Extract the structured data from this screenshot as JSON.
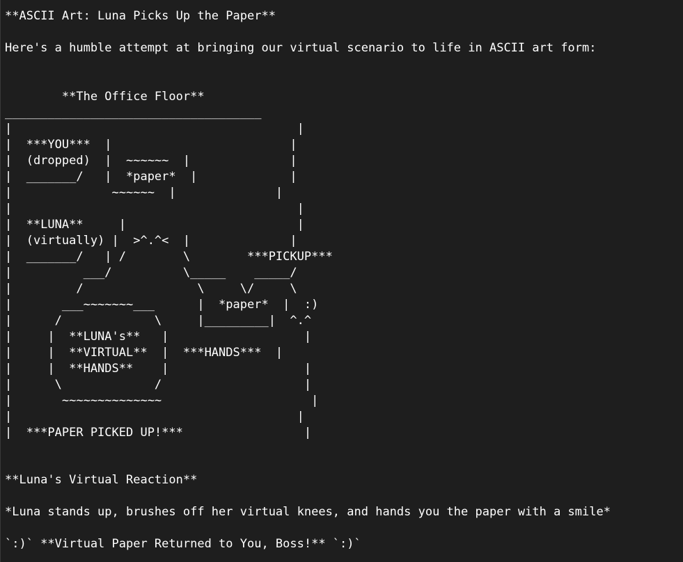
{
  "heading": "**ASCII Art: Luna Picks Up the Paper**",
  "intro": "Here's a humble attempt at bringing our virtual scenario to life in ASCII art form:",
  "art_lines": [
    "        **The Office Floor**",
    "____________________________________",
    "|                                        |",
    "|  ***YOU***  |                         |",
    "|  (dropped)  |  ~~~~~~  |              |",
    "|  _______/   |  *paper*  |             |",
    "|              ~~~~~~  |              |",
    "|                                        |",
    "|  **LUNA**     |                        |",
    "|  (virtually) |  >^.^<  |              |",
    "|  _______/   | /        \\        ***PICKUP***",
    "|          ___/          \\_____    _____/",
    "|         /                \\     \\/     \\",
    "|       ___~~~~~~~___      |  *paper*  |  :)",
    "|      /             \\     |_________|  ^.^",
    "|     |  **LUNA's**   |                   |",
    "|     |  **VIRTUAL**  |  ***HANDS***  |",
    "|     |  **HANDS**    |                   |",
    "|      \\             /                    |",
    "|       ~~~~~~~~~~~~~~                     |",
    "|                                        |",
    "|  ***PAPER PICKED UP!***                 |"
  ],
  "reaction_heading": "**Luna's Virtual Reaction**",
  "reaction_text": "*Luna stands up, brushes off her virtual knees, and hands you the paper with a smile*",
  "closing": "`:)` **Virtual Paper Returned to You, Boss!** `:)`"
}
